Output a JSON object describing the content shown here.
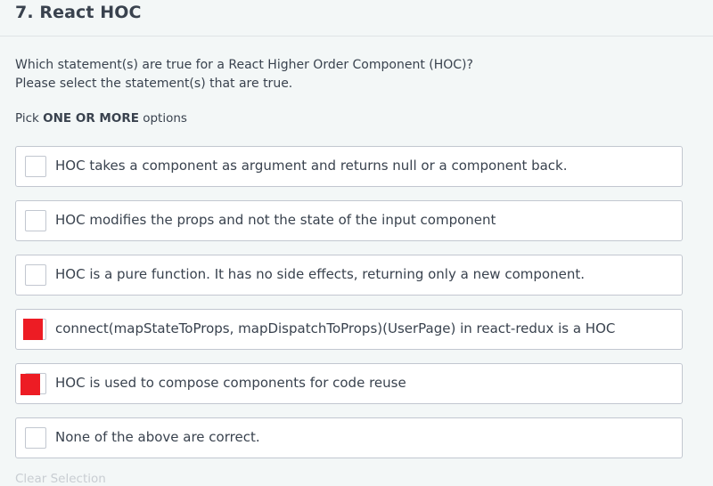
{
  "question": {
    "title": "7. React HOC",
    "prompt_line1": "Which statement(s) are true for a React Higher Order Component (HOC)?",
    "prompt_line2": "Please select the statement(s) that are true.",
    "pick_prefix": "Pick ",
    "pick_emphasis": "ONE OR MORE",
    "pick_suffix": " options"
  },
  "options": [
    {
      "label": "HOC takes a component as argument and returns null or a component back.",
      "marked": false
    },
    {
      "label": "HOC modifies the props and not the state of the input component",
      "marked": false
    },
    {
      "label": "HOC is a pure function. It has no side effects, returning only a new component.",
      "marked": false
    },
    {
      "label": "connect(mapStateToProps, mapDispatchToProps)(UserPage) in react-redux is a HOC",
      "marked": true
    },
    {
      "label": "HOC is used to compose components for code reuse",
      "marked": true
    },
    {
      "label": "None of the above are correct.",
      "marked": false
    }
  ],
  "clear_selection_label": "Clear Selection",
  "colors": {
    "background": "#f3f7f7",
    "text": "#39424e",
    "border": "#c2c7d0",
    "mark": "#ed1c24"
  }
}
